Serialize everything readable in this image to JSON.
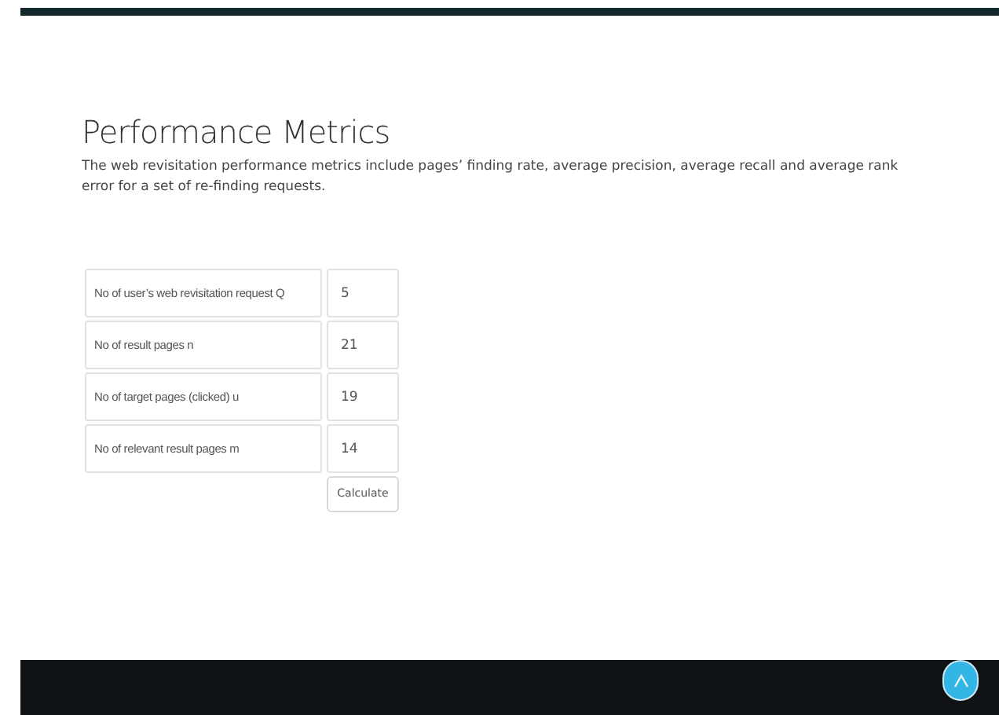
{
  "title": "Performance Metrics",
  "description": "The web revisitation performance metrics include pages’ finding rate, average precision, average recall and average rank error for a set of re-finding requests.",
  "metrics": [
    {
      "label": "No of user’s web revisitation request Q",
      "value": "5"
    },
    {
      "label": "No of result pages n",
      "value": "21"
    },
    {
      "label": "No of target pages (clicked) u",
      "value": "19"
    },
    {
      "label": "No of relevant result pages m",
      "value": "14"
    }
  ],
  "button": "Calculate"
}
